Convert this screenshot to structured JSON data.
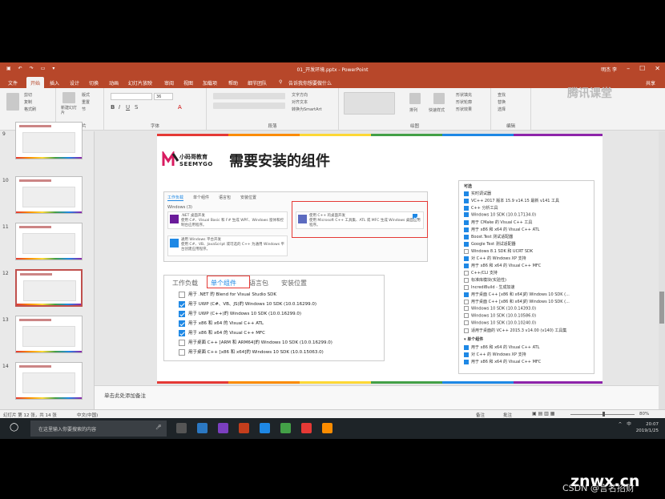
{
  "window": {
    "title": "01_开发环境.pptx - PowerPoint",
    "user": "明杰 李"
  },
  "tabs": [
    "文件",
    "开始",
    "插入",
    "设计",
    "切换",
    "动画",
    "幻灯片放映",
    "审阅",
    "视图",
    "加载项",
    "帮助",
    "细节团队"
  ],
  "active_tab": "开始",
  "tell_me": "告诉我你想要做什么",
  "share": "共享",
  "ribbon": {
    "groups": [
      "剪贴板",
      "幻灯片",
      "字体",
      "段落",
      "绘图",
      "编辑"
    ],
    "clipboard": {
      "cut": "剪切",
      "copy": "复制",
      "paint": "格式刷"
    },
    "slides": {
      "new": "新建幻灯片",
      "layout": "版式",
      "reset": "重置",
      "section": "节"
    },
    "font": {
      "size": "36"
    },
    "paragraph": {
      "text_dir": "文字方向",
      "align": "对齐文本",
      "smartart": "转换为SmartArt"
    },
    "drawing": {
      "arrange": "排列",
      "quick": "快速样式",
      "fill": "形状填充",
      "outline": "形状轮廓",
      "effect": "形状效果"
    },
    "editing": {
      "find": "查找",
      "replace": "替换",
      "select": "选择"
    },
    "watermark": "腾讯课堂"
  },
  "thumbnails": [
    {
      "num": "9",
      "selected": false
    },
    {
      "num": "10",
      "selected": false
    },
    {
      "num": "11",
      "selected": false
    },
    {
      "num": "12",
      "selected": true
    },
    {
      "num": "13",
      "selected": false
    },
    {
      "num": "14",
      "selected": false
    }
  ],
  "slide": {
    "logo_line1": "小码哥教育",
    "logo_line2": "SEEMYGO",
    "title": "需要安装的组件",
    "installer1": {
      "tabs": [
        "工作负载",
        "单个组件",
        "语言包",
        "安装位置"
      ],
      "section": "Windows (3)",
      "cards": [
        {
          "title": ".NET 桌面开发",
          "desc": "使用 C#、Visual Basic 和 F# 生成 WPF、Windows 窗体和控制台应用程序。"
        },
        {
          "title": "使用 C++ 的桌面开发",
          "desc": "使用 Microsoft C++ 工具集、ATL 或 MFC 生成 Windows 桌面应用程序。"
        },
        {
          "title": "通用 Windows 平台开发",
          "desc": "使用 C#、VB、JavaScript 或可选的 C++ 为通用 Windows 平台创建应用程序。"
        }
      ]
    },
    "installer2": {
      "tabs": [
        "工作负载",
        "单个组件",
        "语言包",
        "安装位置"
      ],
      "rows": [
        {
          "label": "用于 .NET 的 Blend for Visual Studio SDK",
          "checked": false
        },
        {
          "label": "用于 UWP (C#、VB、JS)的 Windows 10 SDK (10.0.16299.0)",
          "checked": true
        },
        {
          "label": "用于 UWP (C++)的 Windows 10 SDK (10.0.16299.0)",
          "checked": true
        },
        {
          "label": "用于 x86 和 x64 的 Visual C++ ATL",
          "checked": true
        },
        {
          "label": "用于 x86 和 x64 的 Visual C++ MFC",
          "checked": true
        },
        {
          "label": "用于桌面 C++ [ARM 和 ARM64]的 Windows 10 SDK (10.0.16299.0)",
          "checked": false
        },
        {
          "label": "用于桌面 C++ [x86 和 x64]的 Windows 10 SDK (10.0.15063.0)",
          "checked": false
        }
      ]
    },
    "installer3": {
      "header": "可选",
      "rows": [
        {
          "label": "实时调试器",
          "checked": true
        },
        {
          "label": "VC++ 2017 版本 15.9 v14.15 最新 v141 工具",
          "checked": true
        },
        {
          "label": "C++ 分析工具",
          "checked": true
        },
        {
          "label": "Windows 10 SDK (10.0.17134.0)",
          "checked": true
        },
        {
          "label": "用于 CMake 的 Visual C++ 工具",
          "checked": true
        },
        {
          "label": "用于 x86 和 x64 的 Visual C++ ATL",
          "checked": true
        },
        {
          "label": "Boost.Test 测试适配器",
          "checked": true
        },
        {
          "label": "Google Test 测试适配器",
          "checked": true
        },
        {
          "label": "Windows 8.1 SDK 和 UCRT SDK",
          "checked": false
        },
        {
          "label": "对 C++ 的 Windows XP 支持",
          "checked": true
        },
        {
          "label": "用于 x86 和 x64 的 Visual C++ MFC",
          "checked": true
        },
        {
          "label": "C++/CLI 支持",
          "checked": false
        },
        {
          "label": "标准库模块(实验性)",
          "checked": false
        },
        {
          "label": "IncrediBuild - 生成加速",
          "checked": false
        },
        {
          "label": "用于桌面 C++ [x86 和 x64]的 Windows 10 SDK (...",
          "checked": true
        },
        {
          "label": "用于桌面 C++ [x86 和 x64]的 Windows 10 SDK (...",
          "checked": false
        },
        {
          "label": "Windows 10 SDK (10.0.14393.0)",
          "checked": false
        },
        {
          "label": "Windows 10 SDK (10.0.10586.0)",
          "checked": false
        },
        {
          "label": "Windows 10 SDK (10.0.10240.0)",
          "checked": false
        },
        {
          "label": "适用于桌面的 VC++ 2015.3 v14.00 (v140) 工具集",
          "checked": false
        }
      ],
      "section2": "单个组件",
      "rows2": [
        {
          "label": "用于 x86 和 x64 的 Visual C++ ATL",
          "checked": true
        },
        {
          "label": "对 C++ 的 Windows XP 支持",
          "checked": true
        },
        {
          "label": "用于 x86 和 x64 的 Visual C++ MFC",
          "checked": true
        }
      ]
    }
  },
  "notes_placeholder": "单击此处添加备注",
  "status": {
    "slide": "幻灯片 第 12 张，共 14 张",
    "lang": "中文(中国)",
    "notes": "备注",
    "comments": "批注",
    "zoom": "80%"
  },
  "taskbar": {
    "search": "在这里输入你要搜索的内容",
    "time": "20:07",
    "date": "2019/1/25",
    "ime": "中"
  },
  "watermark": {
    "site": "znwx.cn",
    "author": "CSDN @言名招财"
  }
}
